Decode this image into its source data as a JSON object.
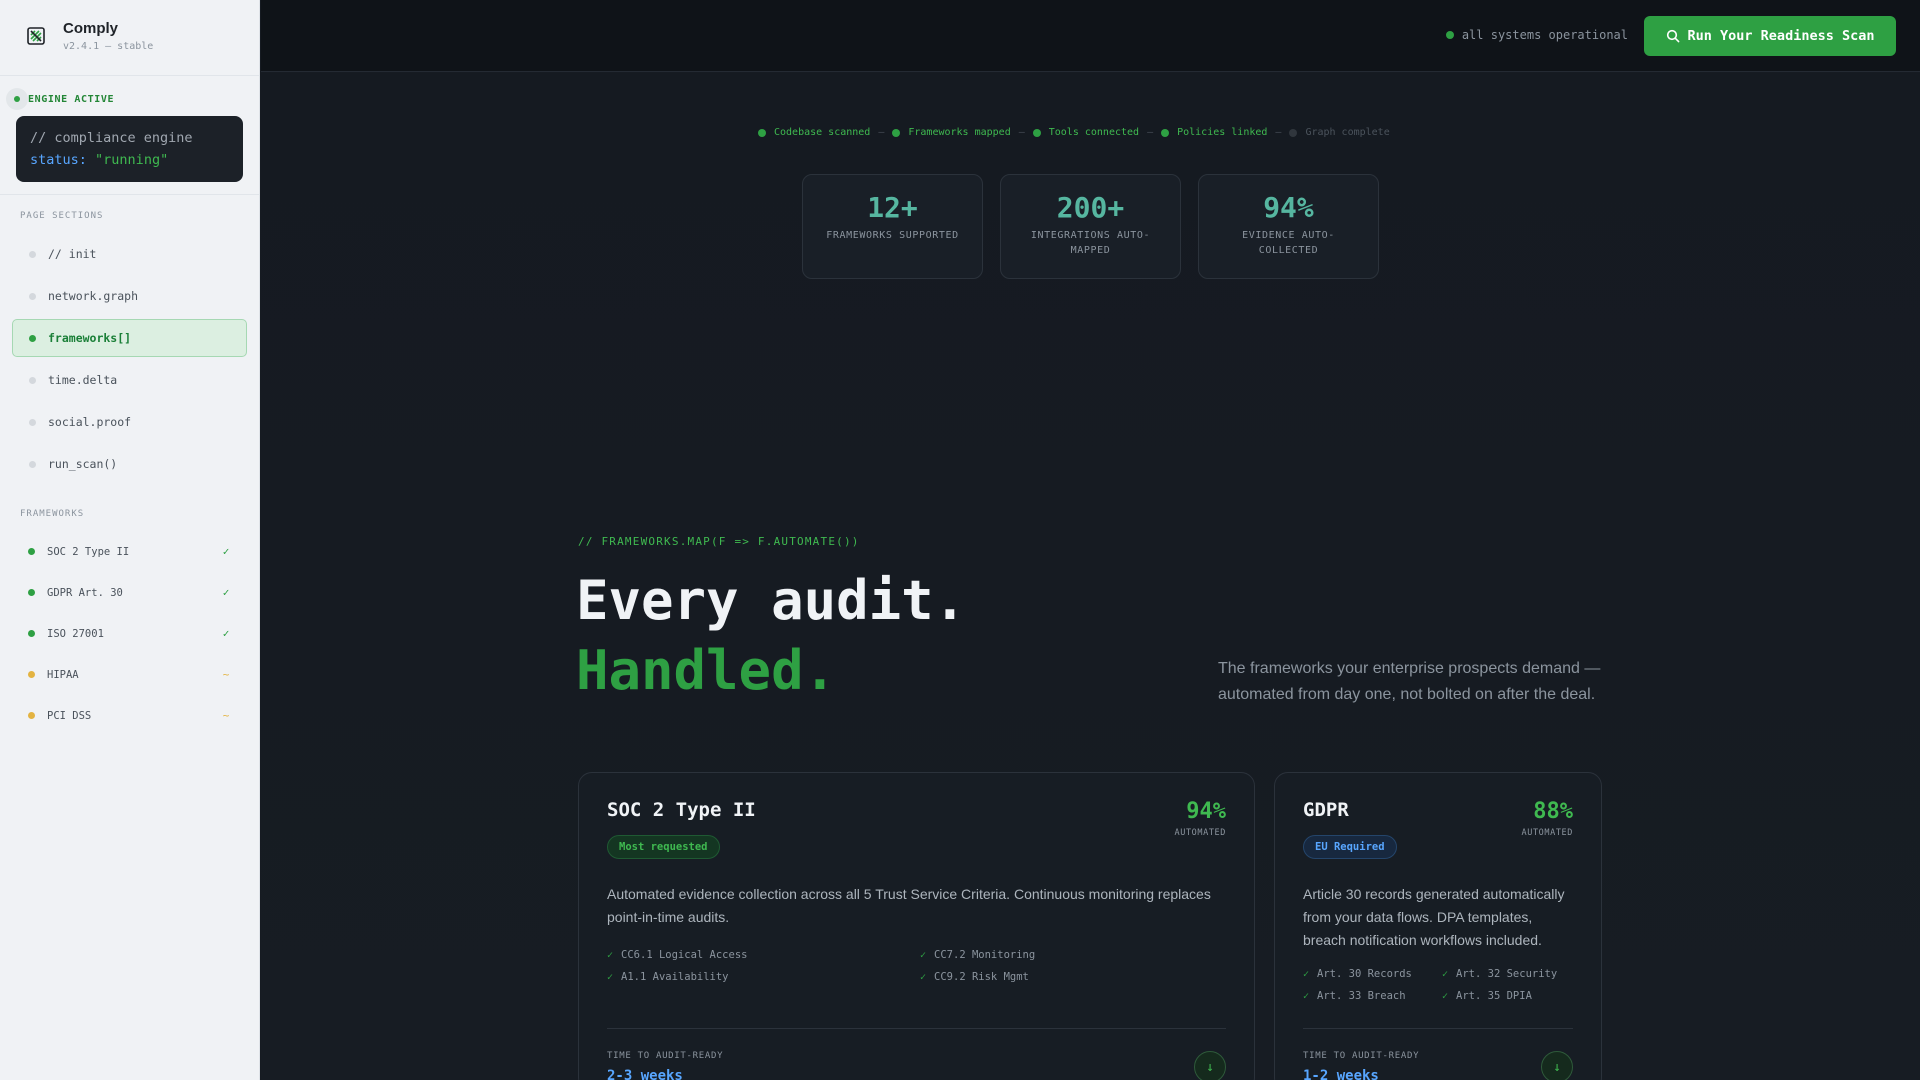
{
  "brand": {
    "name": "Comply",
    "version": "v2.4.1 — stable"
  },
  "engine": {
    "status": "ENGINE ACTIVE",
    "comment": "// compliance engine",
    "key": "status:",
    "value": "\"running\""
  },
  "nav": {
    "title": "PAGE SECTIONS",
    "items": [
      {
        "label": "// init"
      },
      {
        "label": "network.graph"
      },
      {
        "label": "frameworks[]"
      },
      {
        "label": "time.delta"
      },
      {
        "label": "social.proof"
      },
      {
        "label": "run_scan()"
      }
    ]
  },
  "frameworks_nav": {
    "title": "FRAMEWORKS",
    "items": [
      {
        "label": "SOC 2 Type II",
        "mark": "✓",
        "color": "#2ea043"
      },
      {
        "label": "GDPR Art. 30",
        "mark": "✓",
        "color": "#2ea043"
      },
      {
        "label": "ISO 27001",
        "mark": "✓",
        "color": "#2ea043"
      },
      {
        "label": "HIPAA",
        "mark": "~",
        "color": "#e3b341"
      },
      {
        "label": "PCI DSS",
        "mark": "~",
        "color": "#e3b341"
      }
    ]
  },
  "topbar": {
    "status": "all systems operational",
    "cta": "Run Your Readiness Scan"
  },
  "progress": {
    "steps": [
      {
        "label": "Codebase scanned",
        "done": true
      },
      {
        "label": "Frameworks mapped",
        "done": true
      },
      {
        "label": "Tools connected",
        "done": true
      },
      {
        "label": "Policies linked",
        "done": true
      },
      {
        "label": "Graph complete",
        "done": false
      }
    ],
    "separator": "—"
  },
  "stats": [
    {
      "value": "12+",
      "label": "Frameworks supported"
    },
    {
      "value": "200+",
      "label": "Integrations auto-mapped"
    },
    {
      "value": "94%",
      "label": "Evidence auto-collected"
    }
  ],
  "section": {
    "tag": "// FRAMEWORKS.MAP(F => F.AUTOMATE())",
    "headline_1": "Every audit.",
    "headline_2": "Handled.",
    "lede": "The frameworks your enterprise prospects demand — automated from day one, not bolted on after the deal."
  },
  "cards": {
    "soc": {
      "title": "SOC 2 Type II",
      "badge": "Most requested",
      "pct": "94%",
      "pct_label": "AUTOMATED",
      "desc": "Automated evidence collection across all 5 Trust Service Criteria. Continuous monitoring replaces point-in-time audits.",
      "checks": [
        "CC6.1 Logical Access",
        "CC7.2 Monitoring",
        "A1.1 Availability",
        "CC9.2 Risk Mgmt"
      ],
      "foot_label": "TIME TO AUDIT-READY",
      "foot_value": "2-3 weeks"
    },
    "gdpr": {
      "title": "GDPR",
      "badge": "EU Required",
      "pct": "88%",
      "pct_label": "AUTOMATED",
      "desc": "Article 30 records generated automatically from your data flows. DPA templates, breach notification workflows included.",
      "checks": [
        "Art. 30 Records",
        "Art. 32 Security",
        "Art. 33 Breach",
        "Art. 35 DPIA"
      ],
      "foot_label": "TIME TO AUDIT-READY",
      "foot_value": "1-2 weeks"
    }
  },
  "icons": {
    "check": "✓",
    "arrow_down": "↓",
    "search": "search-icon"
  },
  "colors": {
    "accent": "#2ea043",
    "accent_text": "#3fb950",
    "stat": "#56b6a0",
    "info": "#58a6ff",
    "warn": "#e3b341",
    "bg": "#161b22"
  }
}
